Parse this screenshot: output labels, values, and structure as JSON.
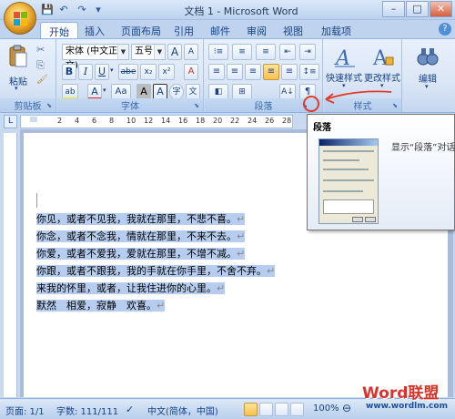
{
  "window": {
    "title": "文档 1 - Microsoft Word",
    "controls": {
      "minimize": "–",
      "maximize": "□",
      "close": "✕"
    }
  },
  "quick_access": {
    "save": "💾",
    "undo": "↶",
    "redo": "↷",
    "customize": "▾"
  },
  "tabs": [
    "开始",
    "插入",
    "页面布局",
    "引用",
    "邮件",
    "审阅",
    "视图",
    "加载项"
  ],
  "active_tab": "开始",
  "help": "?",
  "ribbon": {
    "clipboard": {
      "label": "剪贴板",
      "paste": "粘贴",
      "cut": "✂",
      "copy": "⎘",
      "format_painter": "🖌"
    },
    "font": {
      "label": "字体",
      "font_name": "宋体 (中文正文)",
      "font_size": "五号",
      "grow": "A",
      "shrink": "A",
      "clear": "A",
      "bold": "B",
      "italic": "I",
      "underline": "U",
      "strike": "abe",
      "subscript": "x₂",
      "superscript": "x²",
      "change_case": "Aa",
      "highlight": "ab",
      "font_color": "A",
      "char_shading": "A",
      "char_border": "A",
      "enclose": "字",
      "phonetic": "文"
    },
    "paragraph": {
      "label": "段落"
    },
    "styles": {
      "label": "样式",
      "quick_styles": "快速样式",
      "change_styles": "更改样式"
    },
    "editing": {
      "label": "编辑"
    }
  },
  "tooltip": {
    "title": "段落",
    "description": "显示“段落”对话"
  },
  "document": {
    "lines": [
      "你见，或者不见我，我就在那里，不悲不喜。",
      "你念，或者不念我，情就在那里，不来不去。",
      "你爱，或者不爱我，爱就在那里，不增不减。",
      "你跟，或者不跟我，我的手就在你手里，不舍不弃。",
      "来我的怀里，或者，让我住进你的心里。",
      "默然　相爱，寂静　欢喜。"
    ],
    "para_mark": "↵"
  },
  "ruler": {
    "numbers": [
      "2",
      "4",
      "6",
      "8",
      "10",
      "12",
      "14",
      "16",
      "18",
      "20",
      "22",
      "24",
      "26",
      "28"
    ]
  },
  "status": {
    "page": "页面: 1/1",
    "words": "字数: 111/111",
    "language": "中文(简体，中国)",
    "zoom": "100%",
    "zoom_out": "⊖",
    "zoom_in": "⊕"
  },
  "watermark": {
    "brand": "Word联盟",
    "url": "www.wordlm.com"
  },
  "colors": {
    "accent": "#15428b",
    "selection": "#b6cdef",
    "ribbon": "#dbe6f6",
    "annotation": "#e23b2b"
  }
}
